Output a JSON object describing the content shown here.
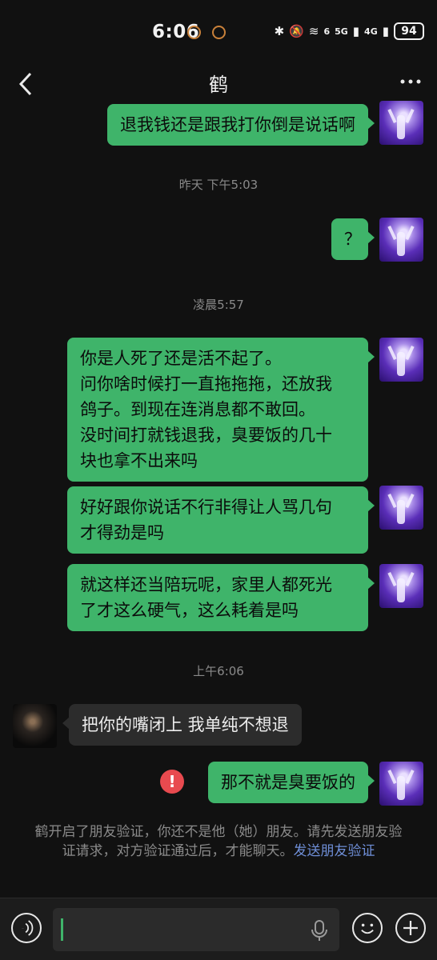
{
  "status_bar": {
    "time": "6:06",
    "network_labels": [
      "6",
      "5G",
      "4G"
    ],
    "battery": "94"
  },
  "header": {
    "title": "鹤"
  },
  "messages": [
    {
      "from": "me",
      "text": "退我钱还是跟我打你倒是说话啊"
    },
    {
      "type": "time",
      "text": "昨天 下午5:03"
    },
    {
      "from": "me",
      "text": "？"
    },
    {
      "type": "time",
      "text": "凌晨5:57"
    },
    {
      "from": "me",
      "lines": [
        "你是人死了还是活不起了。",
        "问你啥时候打一直拖拖拖，还放我",
        "鸽子。到现在连消息都不敢回。",
        "没时间打就钱退我，臭要饭的几十",
        "块也拿不出来吗"
      ]
    },
    {
      "from": "me",
      "lines": [
        "好好跟你说话不行非得让人骂几句",
        "才得劲是吗"
      ]
    },
    {
      "from": "me",
      "lines": [
        "就这样还当陪玩呢，家里人都死光",
        "了才这么硬气，这么耗着是吗"
      ]
    },
    {
      "type": "time",
      "text": "上午6:06"
    },
    {
      "from": "other",
      "text": "把你的嘴闭上  我单纯不想退"
    },
    {
      "from": "me",
      "text": "那不就是臭要饭的",
      "failed": true
    }
  ],
  "system_notice": {
    "text": "鹤开启了朋友验证，你还不是他（她）朋友。请先发送朋友验证请求，对方验证通过后，才能聊天。",
    "link": "发送朋友验证"
  },
  "icons": {
    "back": "back-arrow-icon",
    "more": "more-icon",
    "voice": "voice-icon",
    "mic": "mic-icon",
    "emoji": "emoji-icon",
    "add": "plus-icon",
    "error": "error-icon"
  },
  "colors": {
    "my_bubble": "#3fb46a",
    "other_bubble": "#2c2c2c",
    "background": "#111111",
    "error": "#e84a4f",
    "link": "#6f8fd8"
  }
}
